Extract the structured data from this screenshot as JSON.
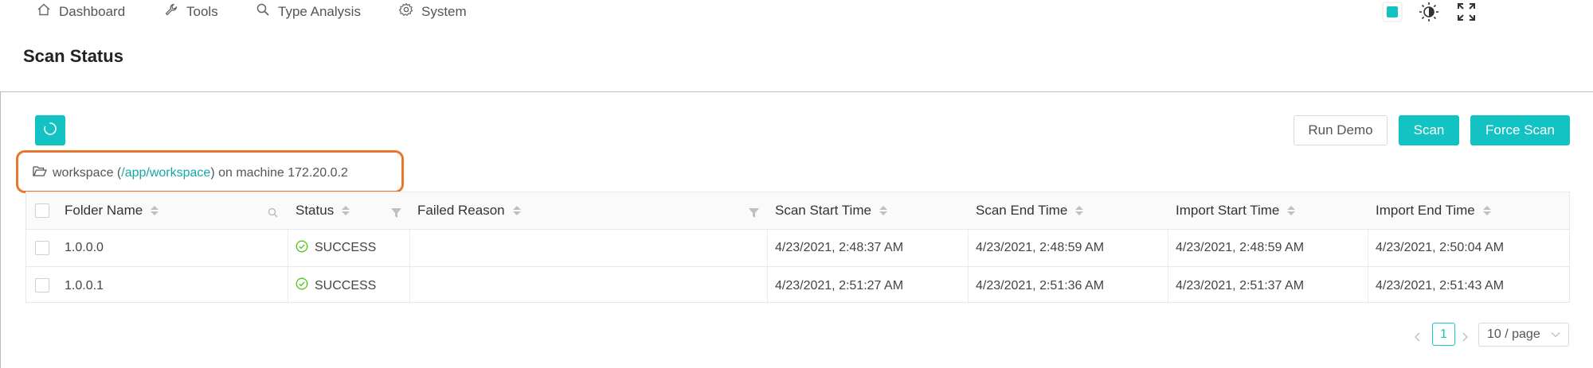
{
  "nav": {
    "items": [
      {
        "label": "Dashboard",
        "icon": "home-icon"
      },
      {
        "label": "Tools",
        "icon": "wrench-icon"
      },
      {
        "label": "Type Analysis",
        "icon": "search-icon"
      },
      {
        "label": "System",
        "icon": "gear-icon"
      }
    ],
    "right_icons": [
      "color-swatch-icon",
      "brightness-icon",
      "fullscreen-icon"
    ]
  },
  "page": {
    "title": "Scan Status"
  },
  "toolbar": {
    "refresh_icon": "refresh-icon",
    "run_demo_label": "Run Demo",
    "scan_label": "Scan",
    "force_scan_label": "Force Scan"
  },
  "workspace": {
    "icon": "folder-open-icon",
    "prefix": "workspace (",
    "path": "/app/workspace",
    "suffix": ") on machine 172.20.0.2"
  },
  "table": {
    "columns": [
      {
        "label": "Folder Name",
        "filter_icon": "search-icon"
      },
      {
        "label": "Status",
        "filter_icon": "filter-icon"
      },
      {
        "label": "Failed Reason",
        "filter_icon": "filter-icon"
      },
      {
        "label": "Scan Start Time"
      },
      {
        "label": "Scan End Time"
      },
      {
        "label": "Import Start Time"
      },
      {
        "label": "Import End Time"
      }
    ],
    "rows": [
      {
        "folder": "1.0.0.0",
        "status": "SUCCESS",
        "failed_reason": "",
        "scan_start": "4/23/2021, 2:48:37 AM",
        "scan_end": "4/23/2021, 2:48:59 AM",
        "import_start": "4/23/2021, 2:48:59 AM",
        "import_end": "4/23/2021, 2:50:04 AM"
      },
      {
        "folder": "1.0.0.1",
        "status": "SUCCESS",
        "failed_reason": "",
        "scan_start": "4/23/2021, 2:51:27 AM",
        "scan_end": "4/23/2021, 2:51:36 AM",
        "import_start": "4/23/2021, 2:51:37 AM",
        "import_end": "4/23/2021, 2:51:43 AM"
      }
    ]
  },
  "pagination": {
    "current": "1",
    "page_size": "10 / page"
  },
  "colors": {
    "accent": "#13c2c2",
    "success": "#52c41a",
    "highlight": "#e8772e"
  }
}
